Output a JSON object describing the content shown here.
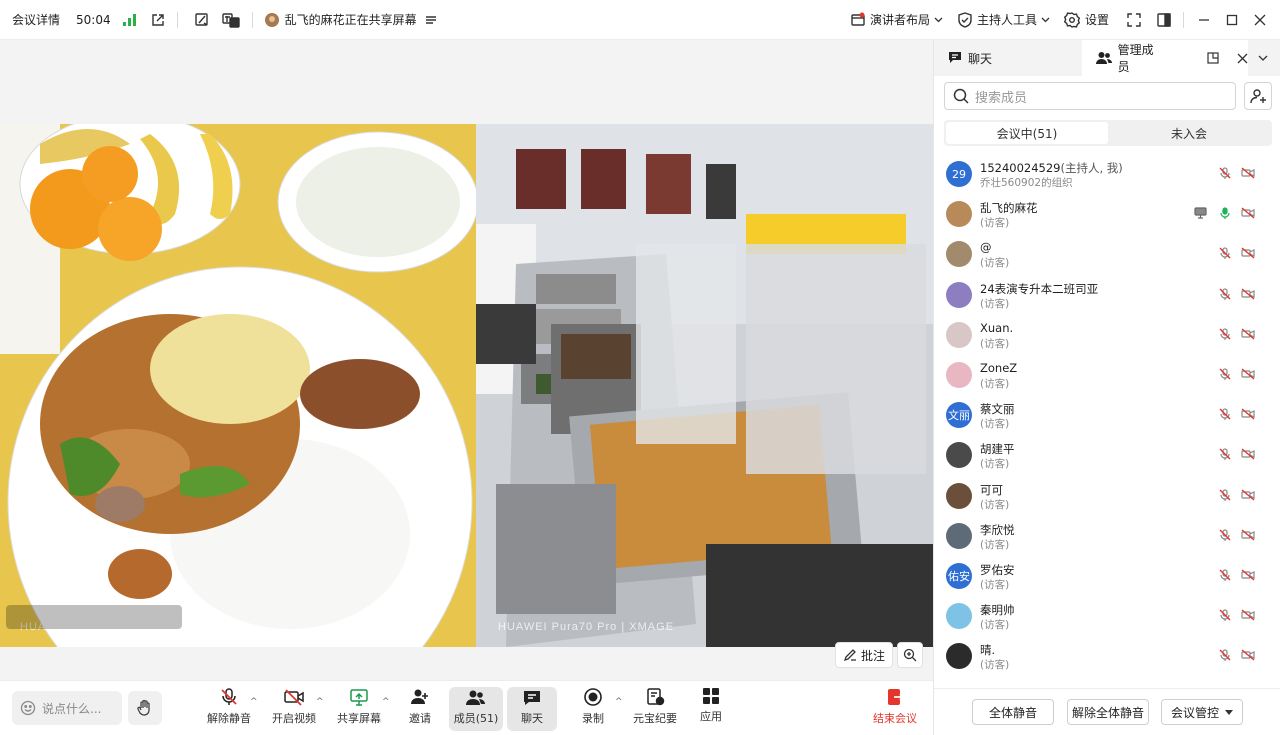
{
  "topbar": {
    "meeting_details": "会议详情",
    "timer": "50:04",
    "sharing_status": "乱飞的麻花正在共享屏幕",
    "layout_label": "演讲者布局",
    "host_tools_label": "主持人工具",
    "settings_label": "设置"
  },
  "share": {
    "watermark_left_brand": "HUAWEI",
    "watermark_left_model": "Pura70 Pro",
    "watermark_left_xmage": "XMAGE",
    "watermark_right_brand": "HUAWEI",
    "watermark_right_model": "Pura70 Pro",
    "watermark_right_xmage": "XMAGE",
    "annotate_label": "批注"
  },
  "bottombar": {
    "chat_placeholder": "说点什么...",
    "unmute": "解除静音",
    "start_video": "开启视频",
    "share_screen": "共享屏幕",
    "invite": "邀请",
    "members": "成员(51)",
    "chat": "聊天",
    "record": "录制",
    "minutes": "元宝纪要",
    "apps": "应用",
    "end_meeting": "结束会议",
    "end_color": "#e5352d"
  },
  "panel": {
    "tab_chat": "聊天",
    "tab_members": "管理成员",
    "search_placeholder": "搜索成员",
    "seg_in_meeting": "会议中(51)",
    "seg_not_joined": "未入会",
    "members": [
      {
        "name": "15240024529",
        "tag": "(主持人, 我)",
        "sub": "乔壮560902的组织",
        "avatar_text": "29",
        "avatar_color": "#2f6fd4",
        "mic": "muted",
        "screen": false
      },
      {
        "name": "乱飞的麻花",
        "tag": "",
        "sub": "(访客)",
        "avatar_text": "",
        "avatar_color": "#b88a5a",
        "mic": "on",
        "screen": true
      },
      {
        "name": "@",
        "tag": "",
        "sub": "(访客)",
        "avatar_text": "",
        "avatar_color": "#a28a6c",
        "mic": "muted",
        "screen": false
      },
      {
        "name": "24表演专升本二班司亚",
        "tag": "",
        "sub": "(访客)",
        "avatar_text": "",
        "avatar_color": "#8d7ec2",
        "mic": "muted",
        "screen": false
      },
      {
        "name": "Xuan.",
        "tag": "",
        "sub": "(访客)",
        "avatar_text": "",
        "avatar_color": "#d9c7c7",
        "mic": "muted",
        "screen": false
      },
      {
        "name": "ZoneZ",
        "tag": "",
        "sub": "(访客)",
        "avatar_text": "",
        "avatar_color": "#e8b7c2",
        "mic": "muted",
        "screen": false
      },
      {
        "name": "蔡文丽",
        "tag": "",
        "sub": "(访客)",
        "avatar_text": "文丽",
        "avatar_color": "#2f6fd4",
        "mic": "muted",
        "screen": false
      },
      {
        "name": "胡建平",
        "tag": "",
        "sub": "(访客)",
        "avatar_text": "",
        "avatar_color": "#4a4a4a",
        "mic": "muted",
        "screen": false
      },
      {
        "name": "可可",
        "tag": "",
        "sub": "(访客)",
        "avatar_text": "",
        "avatar_color": "#6b4f3a",
        "mic": "muted",
        "screen": false
      },
      {
        "name": "李欣悦",
        "tag": "",
        "sub": "(访客)",
        "avatar_text": "",
        "avatar_color": "#5d6b78",
        "mic": "muted",
        "screen": false
      },
      {
        "name": "罗佑安",
        "tag": "",
        "sub": "(访客)",
        "avatar_text": "佑安",
        "avatar_color": "#2f6fd4",
        "mic": "muted",
        "screen": false
      },
      {
        "name": "秦明帅",
        "tag": "",
        "sub": "(访客)",
        "avatar_text": "",
        "avatar_color": "#7ec3e6",
        "mic": "muted",
        "screen": false
      },
      {
        "name": "晴.",
        "tag": "",
        "sub": "(访客)",
        "avatar_text": "",
        "avatar_color": "#2b2b2b",
        "mic": "muted",
        "screen": false
      }
    ],
    "mute_all": "全体静音",
    "unmute_all": "解除全体静音",
    "meeting_control": "会议管控"
  }
}
